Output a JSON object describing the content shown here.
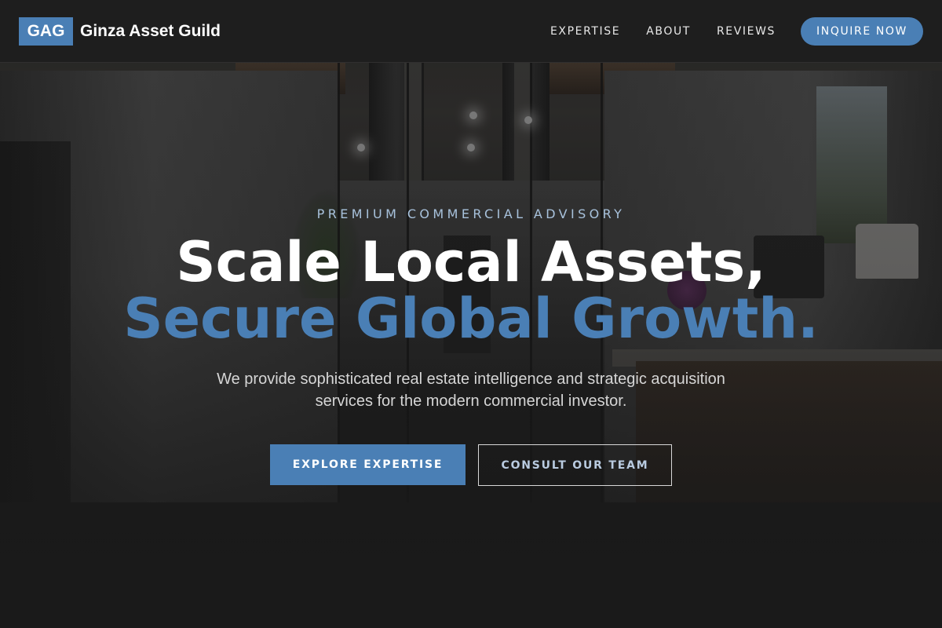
{
  "nav": {
    "logo_mark": "GAG",
    "brand_name": "Ginza Asset Guild",
    "links": [
      "EXPERTISE",
      "ABOUT",
      "REVIEWS"
    ],
    "cta_label": "INQUIRE NOW"
  },
  "hero": {
    "eyebrow": "PREMIUM COMMERCIAL ADVISORY",
    "headline_line1": "Scale Local Assets,",
    "headline_line2": "Secure Global Growth.",
    "subtitle": "We provide sophisticated real estate intelligence and strategic acquisition services for the modern commercial investor.",
    "primary_button": "EXPLORE EXPERTISE",
    "secondary_button": "CONSULT OUR TEAM"
  },
  "colors": {
    "accent": "#4a7fb5",
    "eyebrow": "#a8c2dc",
    "background": "#1c1c1c"
  }
}
